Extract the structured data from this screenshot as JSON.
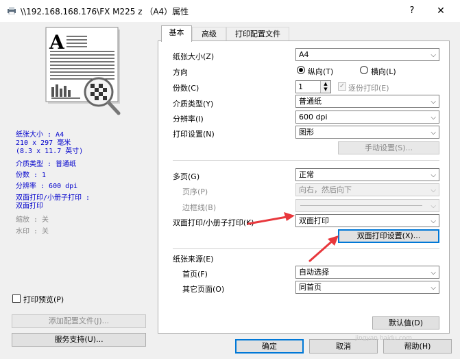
{
  "window": {
    "title": "\\\\192.168.168.176\\FX  M225 z （A4）属性",
    "help": "?",
    "close": "✕"
  },
  "summary": {
    "paper_size": "纸张大小 : A4",
    "dims_mm": "210 x 297 毫米",
    "dims_in": "(8.3 x 11.7 英寸)",
    "media_type": "介质类型 : 普通纸",
    "copies": "份数 : 1",
    "resolution": "分辨率 : 600 dpi",
    "duplex_line1": "双面打印/小册子打印 :",
    "duplex_line2": "双面打印",
    "scaling": "缩放 : 关",
    "watermark": "水印 : 关"
  },
  "left": {
    "print_preview": "打印预览(P)",
    "add_profile": "添加配置文件(J)...",
    "support": "服务支持(U)..."
  },
  "tabs": [
    {
      "label": "基本"
    },
    {
      "label": "高级"
    },
    {
      "label": "打印配置文件"
    }
  ],
  "form": {
    "paper_size_label": "纸张大小(Z)",
    "paper_size_value": "A4",
    "orientation_label": "方向",
    "portrait": "纵向(T)",
    "landscape": "横向(L)",
    "copies_label": "份数(C)",
    "copies_value": "1",
    "collate": "逐份打印(E)",
    "media_label": "介质类型(Y)",
    "media_value": "普通纸",
    "resolution_label": "分辨率(I)",
    "resolution_value": "600 dpi",
    "print_settings_label": "打印设置(N)",
    "print_settings_value": "图形",
    "manual_settings": "手动设置(S)...",
    "multipage_label": "多页(G)",
    "multipage_value": "正常",
    "page_order_label": "页序(P)",
    "page_order_value": "向右，然后向下",
    "border_label": "边框线(B)",
    "duplex_label": "双面打印/小册子打印(K)",
    "duplex_value": "双面打印",
    "duplex_settings": "双面打印设置(X)...",
    "source_label": "纸张来源(E)",
    "first_page_label": "首页(F)",
    "first_page_value": "自动选择",
    "other_pages_label": "其它页面(O)",
    "other_pages_value": "同首页",
    "default": "默认值(D)"
  },
  "footer": {
    "ok": "确定",
    "cancel": "取消",
    "help": "帮助(H)"
  },
  "watermark_text": "jingyan.baidu.com",
  "colors": {
    "summary_text": "#0000cc",
    "annotation_arrow": "#e8373c",
    "focus_border": "#0078d7"
  }
}
